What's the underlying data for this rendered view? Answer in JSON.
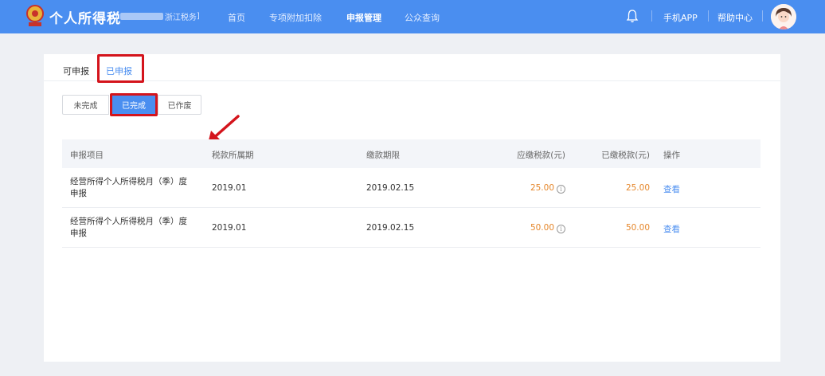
{
  "header": {
    "title": "个人所得税",
    "region_open": "[",
    "region": "浙江税务",
    "region_close": "]",
    "nav": [
      "首页",
      "专项附加扣除",
      "申报管理",
      "公众查询"
    ],
    "app_link": "手机APP",
    "help_link": "帮助中心"
  },
  "tabs": {
    "available": "可申报",
    "done": "已申报"
  },
  "status_filter": [
    "未完成",
    "已完成",
    "已作废"
  ],
  "table": {
    "headers": [
      "申报项目",
      "税款所属期",
      "缴款期限",
      "应缴税款(元)",
      "已缴税款(元)",
      "操作"
    ],
    "rows": [
      {
        "item_line1": "经营所得个人所得税月（季）度",
        "item_line2": "申报",
        "period": "2019.01",
        "deadline": "2019.02.15",
        "due": "25.00",
        "paid": "25.00",
        "action": "查看"
      },
      {
        "item_line1": "经营所得个人所得税月（季）度",
        "item_line2": "申报",
        "period": "2019.01",
        "deadline": "2019.02.15",
        "due": "50.00",
        "paid": "50.00",
        "action": "查看"
      }
    ]
  },
  "colors": {
    "brand": "#4a8ef0",
    "highlight": "#d4141c",
    "amount": "#e5862a"
  }
}
